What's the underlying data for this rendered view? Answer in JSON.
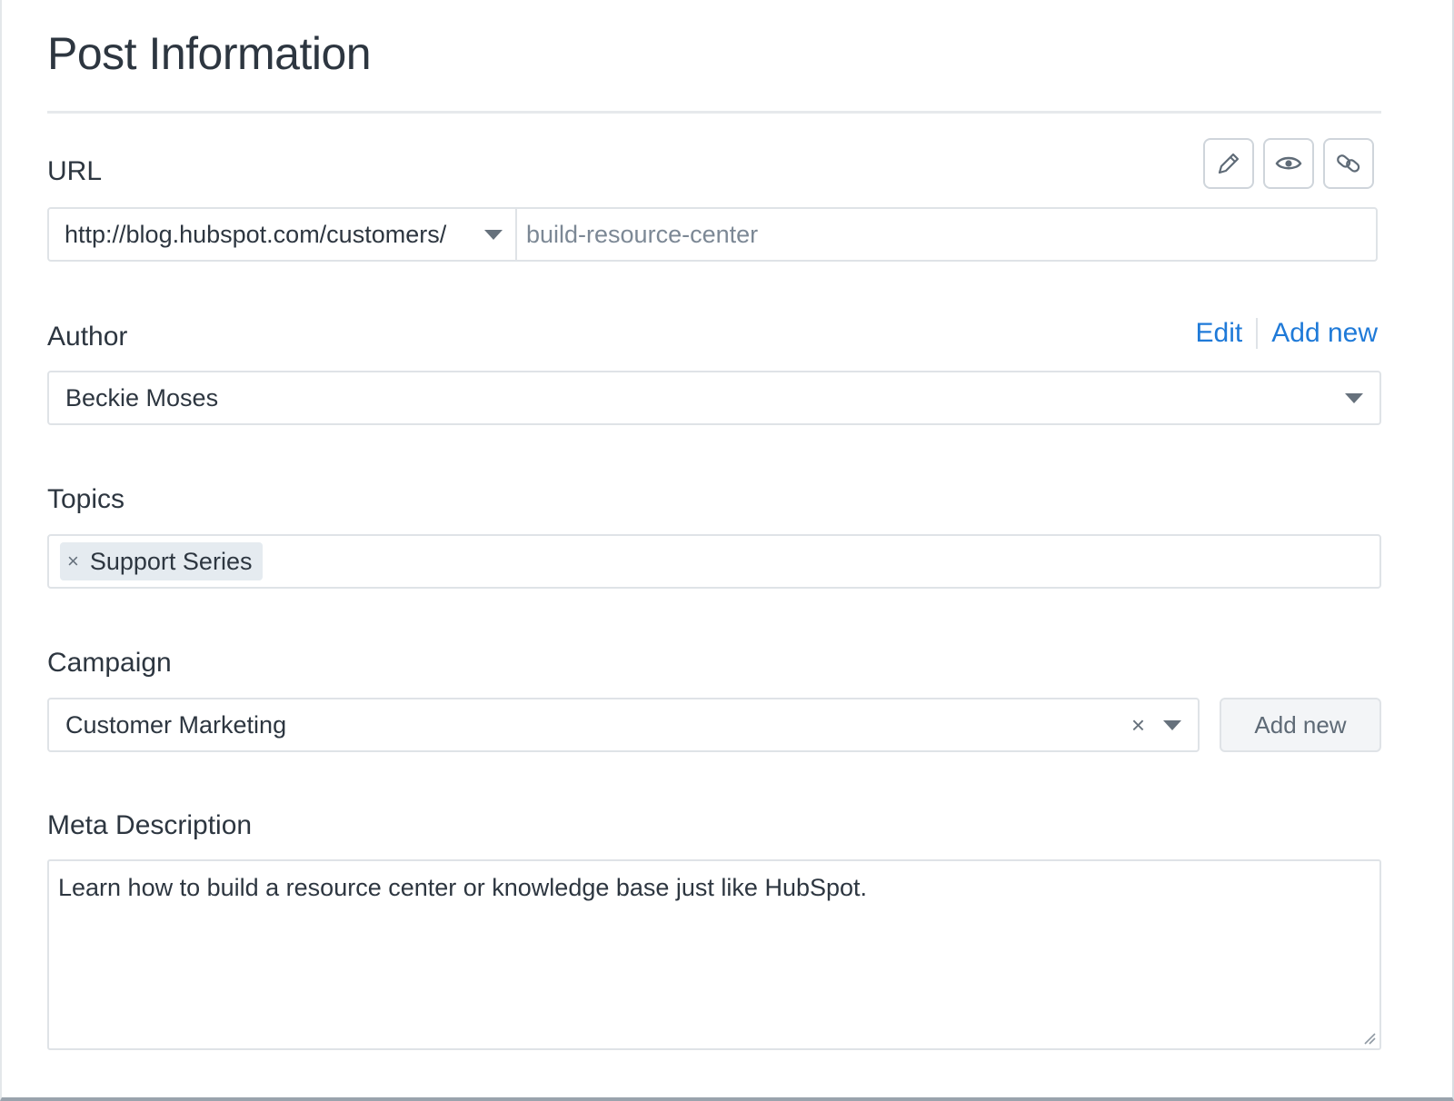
{
  "panel": {
    "title": "Post Information"
  },
  "url": {
    "label": "URL",
    "domain": "http://blog.hubspot.com/customers/",
    "slug": "build-resource-center",
    "tools": [
      {
        "name": "pencil-icon"
      },
      {
        "name": "eye-icon"
      },
      {
        "name": "link-icon"
      }
    ]
  },
  "author": {
    "label": "Author",
    "edit_label": "Edit",
    "add_new_label": "Add new",
    "selected": "Beckie Moses"
  },
  "topics": {
    "label": "Topics",
    "tags": [
      "Support Series"
    ],
    "remove_glyph": "×"
  },
  "campaign": {
    "label": "Campaign",
    "selected": "Customer Marketing",
    "clear_glyph": "×",
    "add_new_label": "Add new"
  },
  "meta": {
    "label": "Meta Description",
    "value": "Learn how to build a resource center or knowledge base just like HubSpot."
  },
  "colors": {
    "link": "#1f7ad8",
    "text": "#2d3640",
    "border": "#dfe3e7",
    "tag_bg": "#e5ebf0"
  }
}
